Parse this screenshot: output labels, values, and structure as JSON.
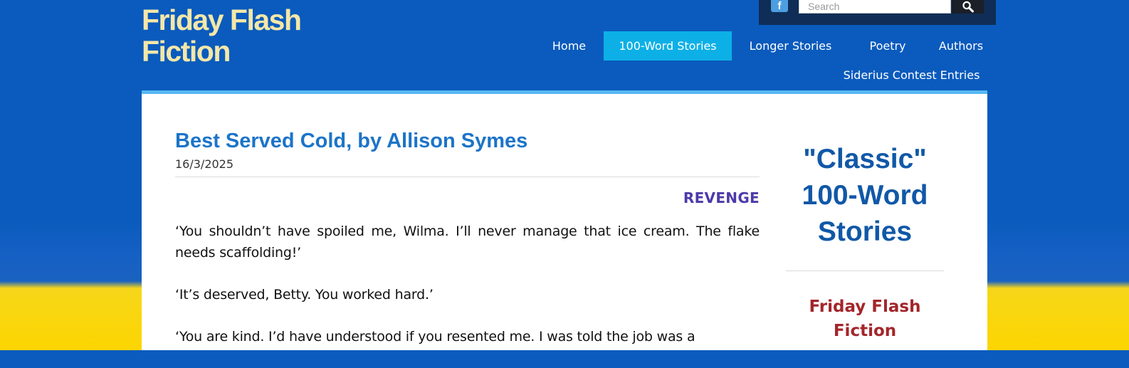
{
  "site": {
    "title": "Friday Flash Fiction"
  },
  "topbar": {
    "facebook_glyph": "f",
    "search_placeholder": "Search"
  },
  "nav": {
    "items": [
      {
        "label": "Home",
        "active": false
      },
      {
        "label": "100-Word Stories",
        "active": true
      },
      {
        "label": "Longer Stories",
        "active": false
      },
      {
        "label": "Poetry",
        "active": false
      },
      {
        "label": "Authors",
        "active": false
      },
      {
        "label": "Siderius Contest Entries",
        "active": false
      }
    ]
  },
  "post": {
    "title": "Best Served Cold, by Allison Symes",
    "date": "16/3/2025",
    "category": "REVENGE",
    "paragraphs": [
      "‘You shouldn’t have spoiled me, Wilma. I’ll never manage that ice cream. The flake needs scaffolding!’",
      "‘It’s deserved, Betty. You worked hard.’",
      "‘You are kind. I’d have understood if you resented me. I was told the job was a"
    ]
  },
  "sidebar": {
    "heading": "\"Classic\" 100-Word Stories",
    "subheading": "Friday Flash Fiction"
  },
  "colors": {
    "brand_blue": "#0a5bbd",
    "nav_active": "#0db0e6",
    "title_yellow": "#f4e7a8",
    "post_title": "#1c74c8",
    "category": "#4d3aa8",
    "sidebar_heading": "#1058a8",
    "sidebar_sub": "#a3262a",
    "ukraine_yellow": "#fcd500"
  },
  "icons": {
    "facebook": "facebook-icon",
    "search": "search-icon"
  }
}
